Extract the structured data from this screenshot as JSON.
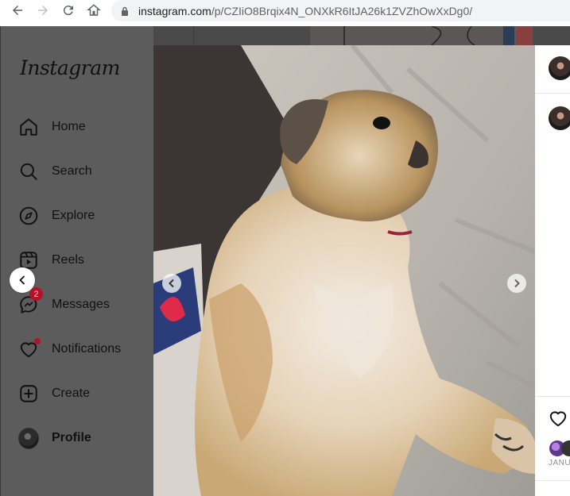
{
  "browser": {
    "url_host": "instagram.com",
    "url_path": "/p/CZIiO8Brqix4N_ONXkR6ItJA26k1ZVZhOwXxDg0/"
  },
  "sidebar": {
    "logo": "Instagram",
    "items": [
      {
        "label": "Home",
        "icon": "home-icon"
      },
      {
        "label": "Search",
        "icon": "search-icon"
      },
      {
        "label": "Explore",
        "icon": "compass-icon"
      },
      {
        "label": "Reels",
        "icon": "reels-icon"
      },
      {
        "label": "Messages",
        "icon": "messenger-icon",
        "badge": "2"
      },
      {
        "label": "Notifications",
        "icon": "heart-icon"
      },
      {
        "label": "Create",
        "icon": "plus-square-icon"
      },
      {
        "label": "Profile",
        "icon": "avatar"
      }
    ]
  },
  "post": {
    "date_label": "JANU"
  },
  "colors": {
    "overlay": "#5c5c5c",
    "badge": "#b3122b"
  }
}
